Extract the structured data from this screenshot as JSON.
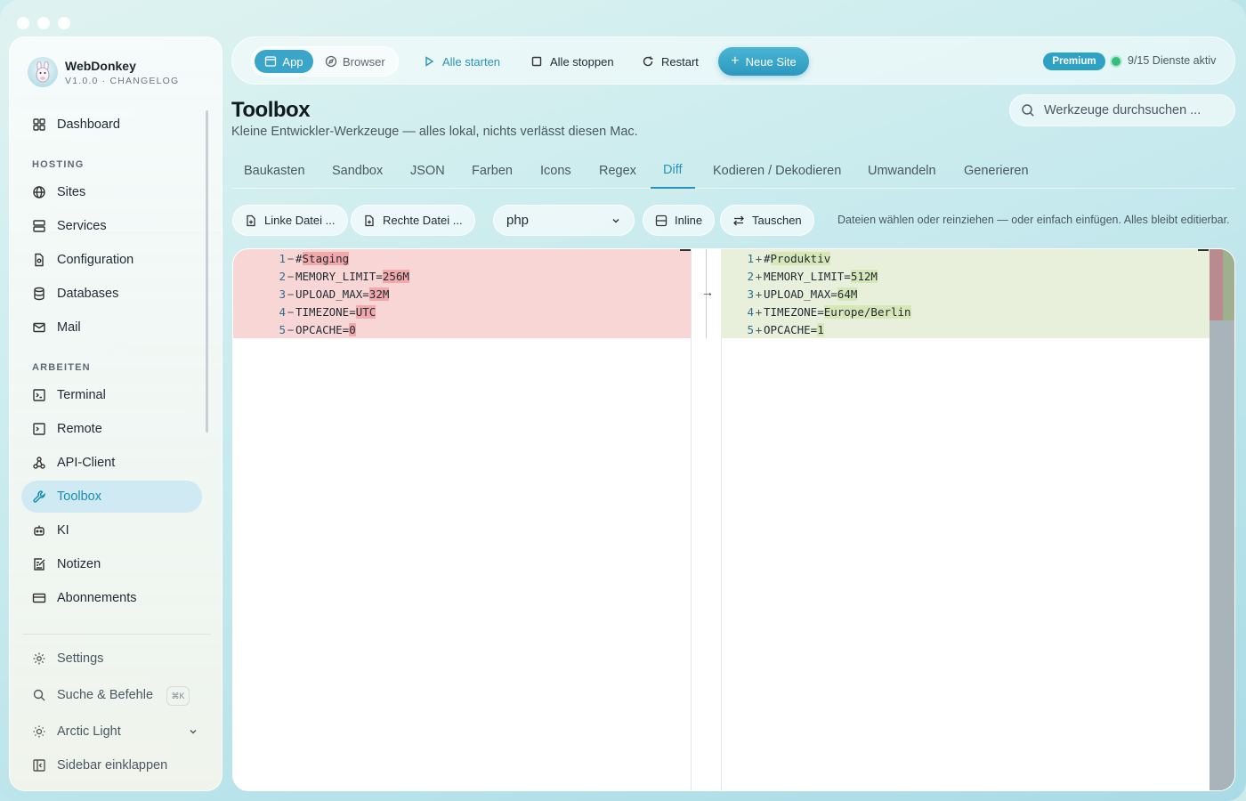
{
  "app": {
    "name": "WebDonkey",
    "version": "V1.0.0 · CHANGELOG"
  },
  "sidebar": {
    "top": [
      {
        "label": "Dashboard",
        "icon": "dashboard-icon"
      }
    ],
    "hosting_title": "HOSTING",
    "hosting": [
      {
        "label": "Sites",
        "icon": "globe-icon"
      },
      {
        "label": "Services",
        "icon": "server-icon"
      },
      {
        "label": "Configuration",
        "icon": "config-file-icon"
      },
      {
        "label": "Databases",
        "icon": "database-icon"
      },
      {
        "label": "Mail",
        "icon": "mail-icon"
      }
    ],
    "work_title": "ARBEITEN",
    "work": [
      {
        "label": "Terminal",
        "icon": "terminal-icon"
      },
      {
        "label": "Remote",
        "icon": "remote-icon"
      },
      {
        "label": "API-Client",
        "icon": "api-icon"
      },
      {
        "label": "Toolbox",
        "icon": "wrench-icon",
        "active": true
      },
      {
        "label": "KI",
        "icon": "robot-icon"
      },
      {
        "label": "Notizen",
        "icon": "notes-icon"
      },
      {
        "label": "Abonnements",
        "icon": "card-icon"
      }
    ],
    "bottom": [
      {
        "label": "Settings",
        "icon": "gear-icon"
      },
      {
        "label": "Suche & Befehle",
        "icon": "search-icon",
        "shortcut": "⌘K"
      },
      {
        "label": "Arctic Light",
        "icon": "sun-icon"
      },
      {
        "label": "Sidebar einklappen",
        "icon": "sidebar-collapse-icon"
      }
    ]
  },
  "toolbar": {
    "app_label": "App",
    "browser_label": "Browser",
    "start_all": "Alle starten",
    "stop_all": "Alle stoppen",
    "restart": "Restart",
    "new_site": "Neue Site",
    "premium": "Premium",
    "services_status": "9/15 Dienste aktiv"
  },
  "page": {
    "title": "Toolbox",
    "subtitle": "Kleine Entwickler-Werkzeuge — alles lokal, nichts verlässt diesen Mac.",
    "search_placeholder": "Werkzeuge durchsuchen ..."
  },
  "tabs": [
    "Baukasten",
    "Sandbox",
    "JSON",
    "Farben",
    "Icons",
    "Regex",
    "Diff",
    "Kodieren / Dekodieren",
    "Umwandeln",
    "Generieren"
  ],
  "active_tab": "Diff",
  "controls": {
    "left_file": "Linke Datei ...",
    "right_file": "Rechte Datei ...",
    "language": "php",
    "inline": "Inline",
    "swap": "Tauschen",
    "hint": "Dateien wählen oder reinziehen — oder einfach einfügen. Alles bleibt editierbar."
  },
  "diff": {
    "left": [
      {
        "n": "1",
        "pre": "# ",
        "hl": "Staging",
        "post": ""
      },
      {
        "n": "2",
        "pre": "MEMORY_LIMIT=",
        "hl": "256M",
        "post": ""
      },
      {
        "n": "3",
        "pre": "UPLOAD_MAX=",
        "hl": "32M",
        "post": ""
      },
      {
        "n": "4",
        "pre": "TIMEZONE=",
        "hl": "UTC",
        "post": ""
      },
      {
        "n": "5",
        "pre": "OPCACHE=",
        "hl": "0",
        "post": ""
      }
    ],
    "right": [
      {
        "n": "1",
        "pre": "# ",
        "hl": "Produktiv",
        "post": ""
      },
      {
        "n": "2",
        "pre": "MEMORY_LIMIT=",
        "hl": "512M",
        "post": ""
      },
      {
        "n": "3",
        "pre": "UPLOAD_MAX=",
        "hl": "64M",
        "post": ""
      },
      {
        "n": "4",
        "pre": "TIMEZONE=",
        "hl": "Europe/Berlin",
        "post": ""
      },
      {
        "n": "5",
        "pre": "OPCACHE=",
        "hl": "1",
        "post": ""
      }
    ]
  },
  "colors": {
    "accent": "#2a93ba",
    "deleted": "#f9d6d6",
    "added": "#e8f0dc",
    "status_dot": "#35c07a"
  }
}
